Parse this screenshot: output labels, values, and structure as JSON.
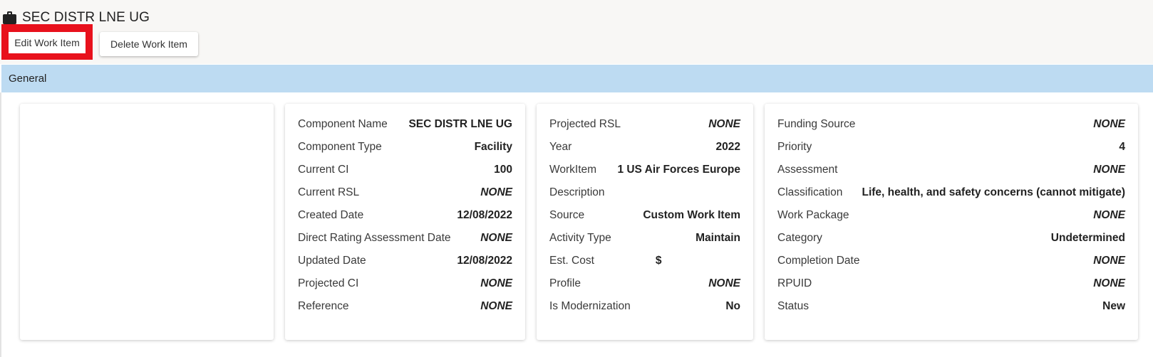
{
  "header": {
    "title": "SEC DISTR LNE UG",
    "icon": "briefcase-icon",
    "edit_button": "Edit Work Item",
    "delete_button": "Delete Work Item"
  },
  "section": {
    "title": "General"
  },
  "colors": {
    "highlight": "#e8111c",
    "section_bar": "#bddbf2",
    "header_bg": "#f8f7f5"
  },
  "columns": [
    {
      "rows": [
        {
          "label": "Component Name",
          "value": "SEC DISTR LNE UG"
        },
        {
          "label": "Component Type",
          "value": "Facility"
        },
        {
          "label": "Current CI",
          "value": "100"
        },
        {
          "label": "Current RSL",
          "value": "NONE"
        },
        {
          "label": "Created Date",
          "value": "12/08/2022"
        },
        {
          "label": "Direct Rating Assessment Date",
          "value": "NONE"
        },
        {
          "label": "Updated Date",
          "value": "12/08/2022"
        },
        {
          "label": "Projected CI",
          "value": "NONE"
        },
        {
          "label": "Reference",
          "value": "NONE"
        }
      ]
    },
    {
      "rows": [
        {
          "label": "Projected RSL",
          "value": "NONE"
        },
        {
          "label": "Year",
          "value": "2022"
        },
        {
          "label": "WorkItem",
          "value": "1 US Air Forces Europe"
        },
        {
          "label": "Description",
          "value": ""
        },
        {
          "label": "Source",
          "value": "Custom Work Item"
        },
        {
          "label": "Activity Type",
          "value": "Maintain"
        },
        {
          "label": "Est. Cost",
          "value": "$"
        },
        {
          "label": "Profile",
          "value": "NONE"
        },
        {
          "label": "Is Modernization",
          "value": "No"
        }
      ]
    },
    {
      "rows": [
        {
          "label": "Funding Source",
          "value": "NONE"
        },
        {
          "label": "Priority",
          "value": "4"
        },
        {
          "label": "Assessment",
          "value": "NONE"
        },
        {
          "label": "Classification",
          "value": "Life, health, and safety concerns (cannot mitigate)"
        },
        {
          "label": "Work Package",
          "value": "NONE"
        },
        {
          "label": "Category",
          "value": "Undetermined"
        },
        {
          "label": "Completion Date",
          "value": "NONE"
        },
        {
          "label": "RPUID",
          "value": "NONE"
        },
        {
          "label": "Status",
          "value": "New"
        }
      ]
    }
  ]
}
